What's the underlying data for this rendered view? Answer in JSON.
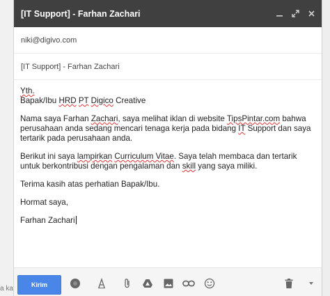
{
  "window": {
    "title": "[IT Support] - Farhan Zachari",
    "minimize_icon": "minimize-icon",
    "popout_icon": "popout-icon",
    "close_icon": "close-icon"
  },
  "to": {
    "value": "niki@digivo.com"
  },
  "subject": {
    "value": "[IT Support] - Farhan Zachari"
  },
  "body": {
    "p1": {
      "a": "Yth.",
      "b": "Bapak/Ibu",
      "c": "HRD",
      "d": "PT",
      "e": "Digico",
      "f": " Creative"
    },
    "p2": {
      "a": "Nama saya Farhan ",
      "b": "Zachari",
      "c": ", saya melihat iklan di website ",
      "d": "TipsPintar.com",
      "e": " bahwa perusahaan anda sedang mencari tenaga kerja pada bidang ",
      "f": "IT",
      "g": " Support dan saya tertarik pada perusahaan anda."
    },
    "p3": {
      "a": "Berikut ini saya ",
      "b": "lampirkan",
      "c": " ",
      "d": "Curriculum Vitae",
      "e": ". Saya telah membaca dan tertarik untuk berkontribusi dengan pengalaman dan ",
      "f": "skill",
      "g": " yang saya miliki."
    },
    "p4": "Terima kasih atas perhatian Bapak/Ibu.",
    "p5": "Hormat saya,",
    "p6": "Farhan Zachari"
  },
  "toolbar": {
    "send_label": "Kirim",
    "icons": [
      "formatting-icon",
      "attach-icon",
      "drive-icon",
      "photo-icon",
      "link-icon",
      "emoji-icon",
      "trash-icon",
      "more-options-icon"
    ]
  },
  "left_strip": {
    "text": "a ka"
  },
  "colors": {
    "titlebar": "#404040",
    "send_button": "#4a86e8",
    "toolbar_bg": "#f5f5f5"
  }
}
